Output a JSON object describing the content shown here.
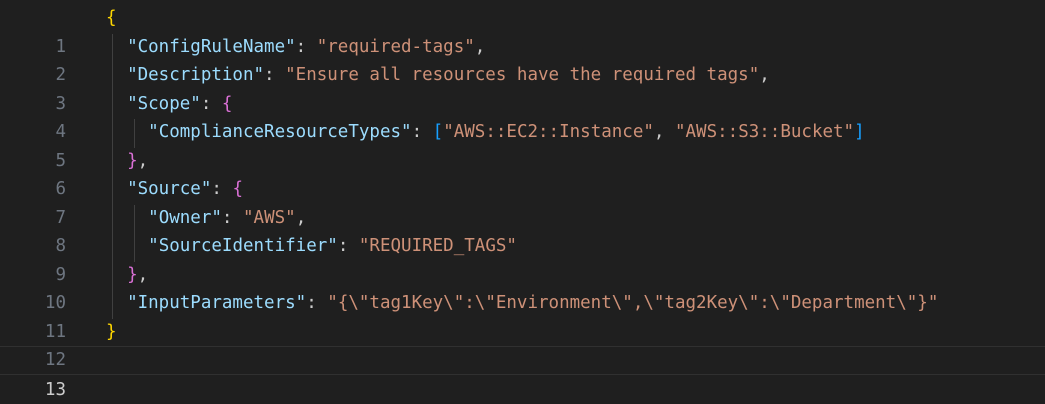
{
  "editor": {
    "line_numbers": [
      "1",
      "2",
      "3",
      "4",
      "5",
      "6",
      "7",
      "8",
      "9",
      "10",
      "11",
      "12",
      "13"
    ],
    "current_line": "13",
    "tokens": {
      "k_config_rule_name": "\"ConfigRuleName\"",
      "v_config_rule_name": "\"required-tags\"",
      "k_description": "\"Description\"",
      "v_description": "\"Ensure all resources have the required tags\"",
      "k_scope": "\"Scope\"",
      "k_compliance_resource_types": "\"ComplianceResourceTypes\"",
      "v_resource_type_1": "\"AWS::EC2::Instance\"",
      "v_resource_type_2": "\"AWS::S3::Bucket\"",
      "k_source": "\"Source\"",
      "k_owner": "\"Owner\"",
      "v_owner": "\"AWS\"",
      "k_source_identifier": "\"SourceIdentifier\"",
      "v_source_identifier": "\"REQUIRED_TAGS\"",
      "k_input_parameters": "\"InputParameters\"",
      "v_input_parameters": "\"{\\\"tag1Key\\\":\\\"Environment\\\",\\\"tag2Key\\\":\\\"Department\\\"}\""
    }
  },
  "colors": {
    "background": "#1f1f1f",
    "line_number": "#6e7681",
    "json_key": "#9cdcfe",
    "json_string": "#ce9178",
    "bracket_level_1": "#ffd700",
    "bracket_level_2": "#da70d6",
    "bracket_level_3": "#179fff"
  }
}
